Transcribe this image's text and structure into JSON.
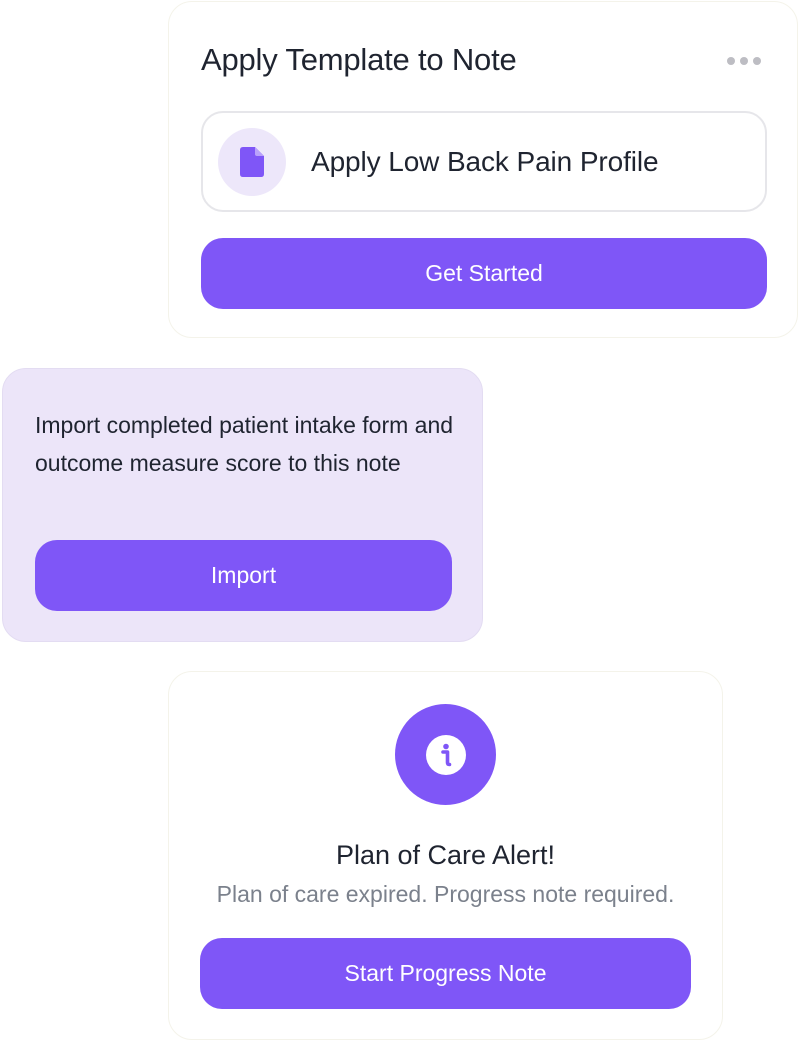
{
  "template_card": {
    "title": "Apply Template to Note",
    "menu_icon": "more-horizontal-icon",
    "profile_option": {
      "icon": "document-icon",
      "label": "Apply Low Back Pain Profile"
    },
    "button_label": "Get Started"
  },
  "import_card": {
    "description": "Import completed patient intake form and outcome measure score to this note",
    "button_label": "Import"
  },
  "alert_card": {
    "icon": "info-icon",
    "title": "Plan of Care Alert!",
    "subtitle": "Plan of care expired. Progress note required.",
    "button_label": "Start Progress Note"
  },
  "colors": {
    "accent": "#7f56f7",
    "accent_light": "#ede7fa",
    "import_card_bg": "#ece5f9",
    "text_primary": "#1f2430",
    "text_secondary": "#7b818c"
  }
}
